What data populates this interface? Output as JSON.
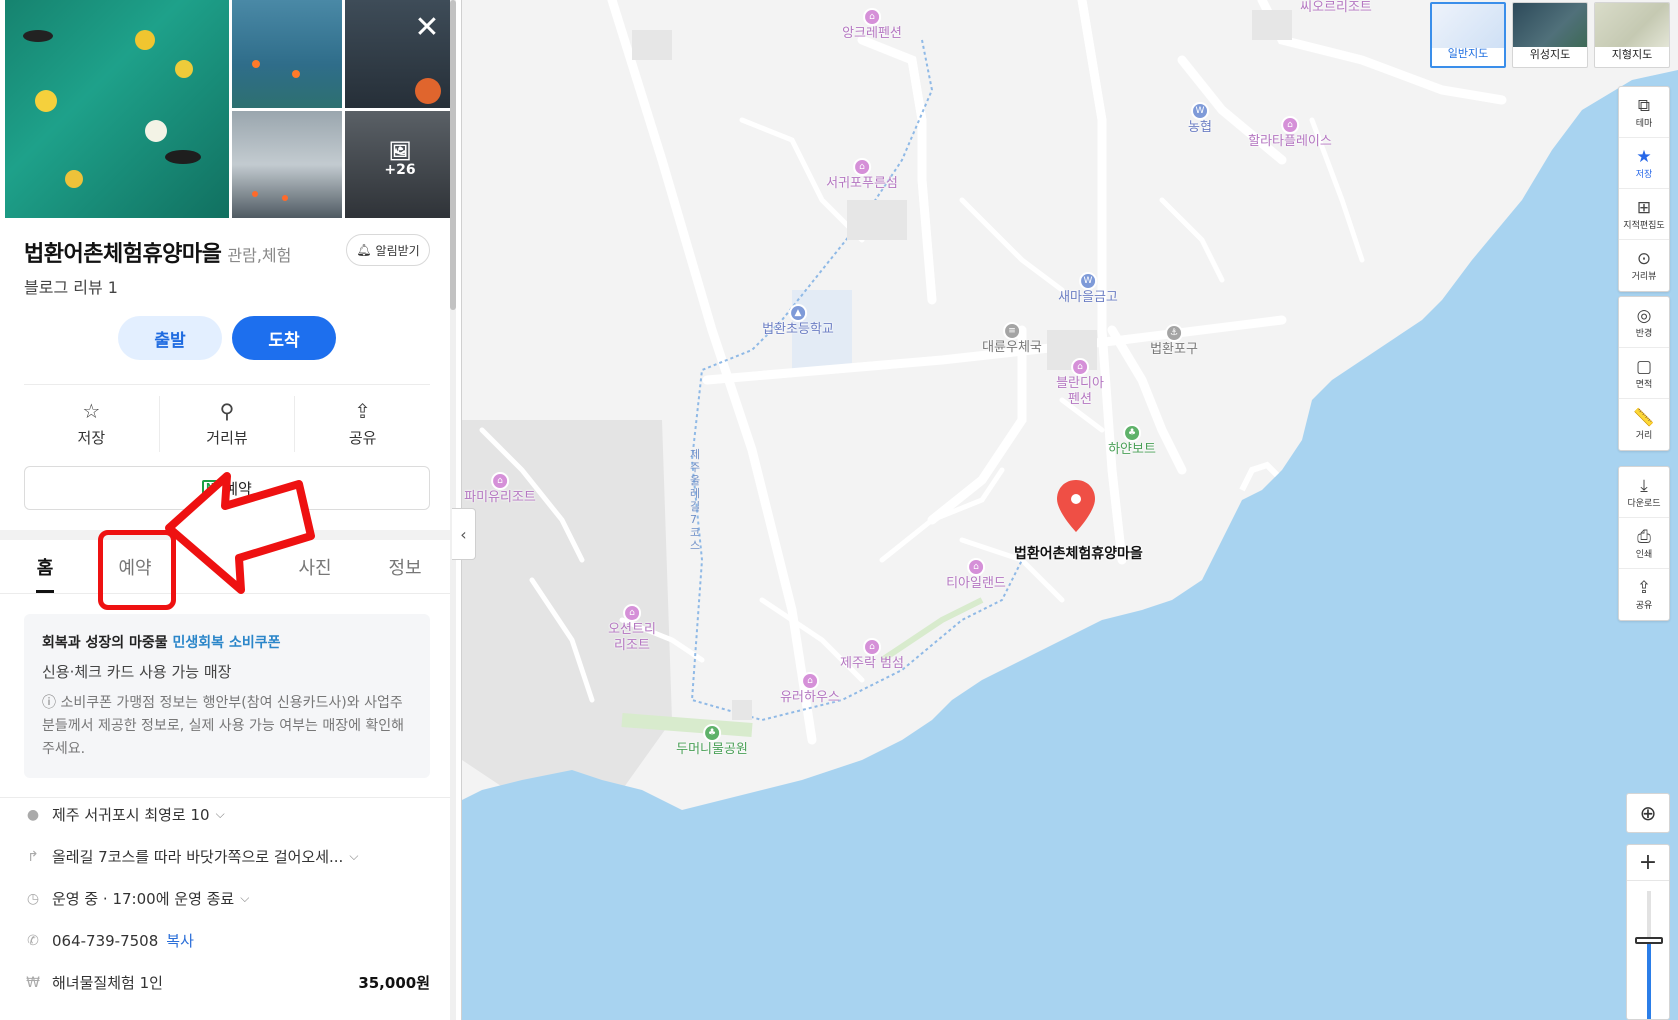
{
  "panel": {
    "title": "법환어촌체험휴양마을",
    "category": "관람,체험",
    "alarm_label": "알림받기",
    "review": "블로그 리뷰 1",
    "photo_more": "+26",
    "start_label": "출발",
    "arrive_label": "도착",
    "actions": [
      {
        "label": "저장",
        "icon": "star-outline-icon"
      },
      {
        "label": "거리뷰",
        "icon": "pin-outline-icon"
      },
      {
        "label": "공유",
        "icon": "share-icon"
      }
    ],
    "reserve_label": "예약",
    "tabs": [
      {
        "label": "홈",
        "active": true
      },
      {
        "label": "예약",
        "active": false
      },
      {
        "label": "",
        "active": false
      },
      {
        "label": "사진",
        "active": false
      },
      {
        "label": "정보",
        "active": false
      }
    ],
    "notice": {
      "line1_prefix": "회복과 성장의 마중물",
      "line1_highlight": "민생회복 소비쿠폰",
      "line2": "신용·체크 카드 사용 가능 매장",
      "line3": "ⓘ 소비쿠폰 가맹점 정보는 행안부(참여 신용카드사)와 사업주분들께서 제공한 정보로, 실제 사용 가능 여부는 매장에 확인해 주세요."
    },
    "info": {
      "address": "제주 서귀포시 최영로 10",
      "directions": "올레길 7코스를 따라 바닷가쪽으로 걸어오세...",
      "hours": "운영 중 · 17:00에 운영 종료",
      "phone": "064-739-7508",
      "copy_label": "복사",
      "menu_item": "해녀물질체험 1인",
      "menu_price": "35,000원"
    }
  },
  "map": {
    "marker_label": "법환어촌체험휴양마을",
    "map_types": [
      {
        "label": "일반지도",
        "active": true
      },
      {
        "label": "위성지도",
        "active": false
      },
      {
        "label": "지형지도",
        "active": false
      }
    ],
    "tools_group1": [
      {
        "label": "테마",
        "icon": "layers-icon"
      },
      {
        "label": "저장",
        "icon": "star-icon"
      },
      {
        "label": "지적편집도",
        "icon": "cadastral-icon"
      },
      {
        "label": "거리뷰",
        "icon": "streetview-icon"
      }
    ],
    "tools_group2": [
      {
        "label": "반경",
        "icon": "radius-icon"
      },
      {
        "label": "면적",
        "icon": "area-icon"
      },
      {
        "label": "거리",
        "icon": "ruler-icon"
      }
    ],
    "tools_group3": [
      {
        "label": "다운로드",
        "icon": "download-icon"
      },
      {
        "label": "인쇄",
        "icon": "print-icon"
      },
      {
        "label": "공유",
        "icon": "share-icon"
      }
    ],
    "zoom_level_fraction": 0.62,
    "pois": [
      {
        "label": "씨오르리조트",
        "kind": "pink"
      },
      {
        "label": "앙크레펜션",
        "kind": "pink"
      },
      {
        "label": "농협",
        "kind": "blue"
      },
      {
        "label": "할라타플레이스",
        "kind": "pink"
      },
      {
        "label": "서귀포푸른섬",
        "kind": "pink"
      },
      {
        "label": "새마을금고",
        "kind": "blue"
      },
      {
        "label": "법환초등학교",
        "kind": "blue"
      },
      {
        "label": "대륜우체국",
        "kind": "gray"
      },
      {
        "label": "법환포구",
        "kind": "gray"
      },
      {
        "label": "블란디아\n펜션",
        "kind": "pink"
      },
      {
        "label": "하얀보트",
        "kind": "green"
      },
      {
        "label": "파미유리조트",
        "kind": "pink"
      },
      {
        "label": "티아일랜드",
        "kind": "pink"
      },
      {
        "label": "오션트리\n리조트",
        "kind": "pink"
      },
      {
        "label": "제주락 범섬",
        "kind": "pink"
      },
      {
        "label": "유러하우스",
        "kind": "pink"
      },
      {
        "label": "두머니물공원",
        "kind": "green"
      }
    ],
    "road_label": "제주올레길7코스"
  }
}
